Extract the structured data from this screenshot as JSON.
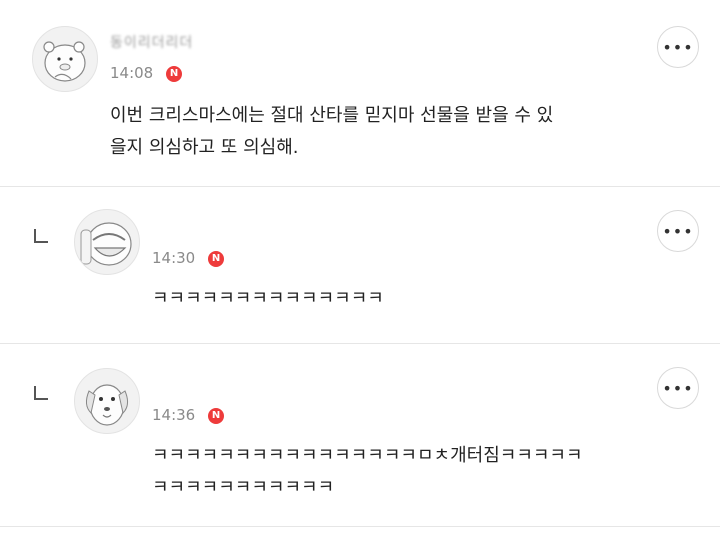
{
  "comments": [
    {
      "author": "동이리더리더",
      "time": "14:08",
      "new_badge": "N",
      "text_lines": [
        "이번 크리스마스에는 절대 산타를 믿지마 선물을 받을 수 있",
        "을지 의심하고 또 의심해."
      ],
      "more_label": "•••",
      "is_reply": false
    },
    {
      "author": "",
      "time": "14:30",
      "new_badge": "N",
      "text_lines": [
        "ㅋㅋㅋㅋㅋㅋㅋㅋㅋㅋㅋㅋㅋㅋ"
      ],
      "more_label": "•••",
      "is_reply": true
    },
    {
      "author": "",
      "time": "14:36",
      "new_badge": "N",
      "text_lines": [
        "ㅋㅋㅋㅋㅋㅋㅋㅋㅋㅋㅋㅋㅋㅋㅋㅋㅁㅊ개터짐ㅋㅋㅋㅋㅋ",
        "ㅋㅋㅋㅋㅋㅋㅋㅋㅋㅋㅋ"
      ],
      "more_label": "•••",
      "is_reply": true
    }
  ],
  "colors": {
    "badge": "#ee3b3b",
    "divider": "#e6e6e6",
    "time": "#8a8a8a"
  }
}
